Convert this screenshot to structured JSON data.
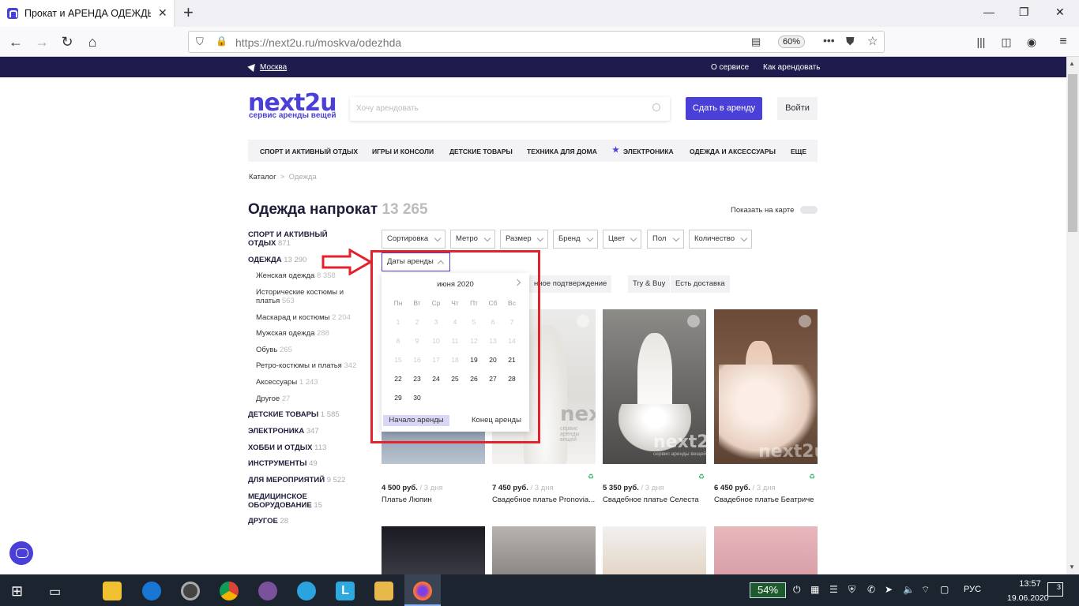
{
  "browser": {
    "tab_title": "Прокат и АРЕНДА ОДЕЖДЫ в",
    "url_host": "https://next2u.ru",
    "url_path": "/moskva/odezhda",
    "zoom": "60%"
  },
  "topstrip": {
    "city": "Москва",
    "about": "О сервисе",
    "how": "Как арендовать"
  },
  "header": {
    "logo": "next2u",
    "tagline": "сервис аренды вещей",
    "search_placeholder": "Хочу арендовать",
    "rent_button": "Сдать в аренду",
    "login_button": "Войти"
  },
  "catnav": [
    "СПОРТ И АКТИВНЫЙ ОТДЫХ",
    "ИГРЫ И КОНСОЛИ",
    "ДЕТСКИЕ ТОВАРЫ",
    "ТЕХНИКА ДЛЯ ДОМА",
    "ЭЛЕКТРОНИКА",
    "ОДЕЖДА И АКСЕССУАРЫ",
    "ЕЩЕ"
  ],
  "breadcrumb": {
    "root": "Каталог",
    "sep": ">",
    "current": "Одежда"
  },
  "page": {
    "title": "Одежда напрокат",
    "count": "13 265",
    "map_label": "Показать на карте"
  },
  "sidebar": {
    "cat1_l1": "СПОРТ И АКТИВНЫЙ",
    "cat1_l2": "ОТДЫХ",
    "cat1_count": "871",
    "cat2": "ОДЕЖДА",
    "cat2_count": "13 290",
    "subs": [
      {
        "l": "Женская одежда",
        "c": "8 358"
      },
      {
        "l": "Исторические костюмы и",
        "c": ""
      },
      {
        "l": "платья",
        "c": "563"
      },
      {
        "l": "Маскарад и костюмы",
        "c": "2 204"
      },
      {
        "l": "Мужская одежда",
        "c": "288"
      },
      {
        "l": "Обувь",
        "c": "265"
      },
      {
        "l": "Ретро-костюмы и платья",
        "c": "342"
      },
      {
        "l": "Аксессуары",
        "c": "1 243"
      },
      {
        "l": "Другое",
        "c": "27"
      }
    ],
    "cats": [
      {
        "l": "ДЕТСКИЕ ТОВАРЫ",
        "c": "1 585"
      },
      {
        "l": "ЭЛЕКТРОНИКА",
        "c": "347"
      },
      {
        "l": "ХОББИ И ОТДЫХ",
        "c": "113"
      },
      {
        "l": "ИНСТРУМЕНТЫ",
        "c": "49"
      },
      {
        "l": "ДЛЯ МЕРОПРИЯТИЙ",
        "c": "9 522"
      },
      {
        "l": "МЕДИЦИНСКОЕ",
        "c": ""
      },
      {
        "l": "ОБОРУДОВАНИЕ",
        "c": "15"
      },
      {
        "l": "ДРУГОЕ",
        "c": "28"
      }
    ]
  },
  "filters": [
    "Сортировка",
    "Метро",
    "Размер",
    "Бренд",
    "Цвет",
    "Пол",
    "Количество"
  ],
  "dates_filter": "Даты аренды",
  "tags": [
    "нное подтверждение",
    "Try & Buy",
    "Есть доставка"
  ],
  "calendar": {
    "month": "июня 2020",
    "weekdays": [
      "Пн",
      "Вт",
      "Ср",
      "Чт",
      "Пт",
      "Сб",
      "Вс"
    ],
    "start": "Начало аренды",
    "end": "Конец аренды"
  },
  "products": [
    {
      "price": "4 500 руб.",
      "per": "/ 3 дня",
      "name": "Платье Люпин"
    },
    {
      "price": "7 450 руб.",
      "per": "/ 3 дня",
      "name": "Свадебное платье Pronovia..."
    },
    {
      "price": "5 350 руб.",
      "per": "/ 3 дня",
      "name": "Свадебное платье Селеста"
    },
    {
      "price": "6 450 руб.",
      "per": "/ 3 дня",
      "name": "Свадебное платье Беатриче"
    }
  ],
  "watermark": "next2u",
  "watermark_sub": "сервис аренды вещей",
  "taskbar": {
    "battery": "54%",
    "lang": "РУС",
    "time": "13:57",
    "date": "19.06.2020",
    "notif": "3"
  },
  "colors": {
    "brand": "#4a3fd6",
    "strip": "#1e1c4d",
    "highlight": "#e3222b"
  }
}
